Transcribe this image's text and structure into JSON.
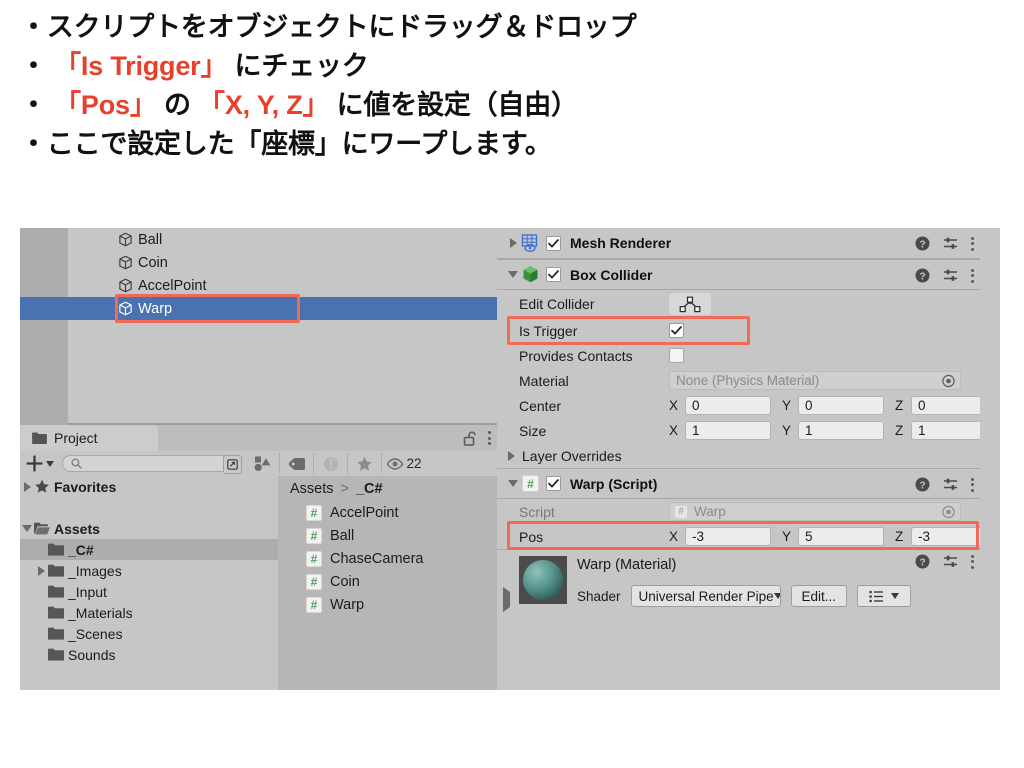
{
  "slide": {
    "bullets": [
      {
        "id": "b1",
        "segments": [
          {
            "t": "・スクリプトをオブジェクトにドラッグ＆ドロップ",
            "c": "black"
          }
        ]
      },
      {
        "id": "b2",
        "segments": [
          {
            "t": "・  ",
            "c": "black"
          },
          {
            "t": "「Is Trigger」",
            "c": "red"
          },
          {
            "t": " にチェック",
            "c": "black"
          }
        ]
      },
      {
        "id": "b3",
        "segments": [
          {
            "t": "・  ",
            "c": "black"
          },
          {
            "t": "「Pos」",
            "c": "red"
          },
          {
            "t": " の ",
            "c": "black"
          },
          {
            "t": "「X, Y, Z」",
            "c": "red"
          },
          {
            "t": " に値を設定（自由）",
            "c": "black"
          }
        ]
      },
      {
        "id": "b4",
        "segments": [
          {
            "t": "・ここで設定した「座標」にワープします。",
            "c": "black"
          }
        ]
      }
    ],
    "accent_red": "#E8412B",
    "text_black": "#111111"
  },
  "hierarchy": {
    "items": [
      {
        "name": "Ball",
        "selected": false
      },
      {
        "name": "Coin",
        "selected": false
      },
      {
        "name": "AccelPoint",
        "selected": false
      },
      {
        "name": "Warp",
        "selected": true
      }
    ],
    "selection_color": "#4a72b0",
    "highlight_color": "#f06a55"
  },
  "project": {
    "tab_label": "Project",
    "lock_icon": "open-padlock-icon",
    "menu_icon": "kebab-menu-icon",
    "add_button_label": "+",
    "search_placeholder": "",
    "visibility_count": "22",
    "toolbar_icons": [
      "object-type-filter-icon",
      "label-filter-icon",
      "warning-filter-icon",
      "favorites-star-icon",
      "eye-icon"
    ],
    "tree": [
      {
        "label": "Favorites",
        "indent": 0,
        "arrow": "right",
        "icon": "star-icon",
        "bold": true,
        "selected": false
      },
      {
        "label": "",
        "indent": 0,
        "arrow": "none",
        "icon": "none",
        "bold": false,
        "selected": false
      },
      {
        "label": "Assets",
        "indent": 0,
        "arrow": "down",
        "icon": "open-folder-icon",
        "bold": true,
        "selected": false
      },
      {
        "label": "_C#",
        "indent": 1,
        "arrow": "none",
        "icon": "folder-icon",
        "bold": true,
        "selected": true
      },
      {
        "label": "_Images",
        "indent": 1,
        "arrow": "right",
        "icon": "folder-icon",
        "bold": false,
        "selected": false
      },
      {
        "label": "_Input",
        "indent": 1,
        "arrow": "none",
        "icon": "folder-icon",
        "bold": false,
        "selected": false
      },
      {
        "label": "_Materials",
        "indent": 1,
        "arrow": "none",
        "icon": "folder-icon",
        "bold": false,
        "selected": false
      },
      {
        "label": "_Scenes",
        "indent": 1,
        "arrow": "none",
        "icon": "folder-icon",
        "bold": false,
        "selected": false
      },
      {
        "label": "Sounds",
        "indent": 1,
        "arrow": "none",
        "icon": "folder-icon",
        "bold": false,
        "selected": false
      }
    ],
    "breadcrumb": {
      "root": "Assets",
      "separator": ">",
      "current": "_C#"
    },
    "assets": [
      {
        "name": "AccelPoint",
        "icon": "csharp-script-icon"
      },
      {
        "name": "Ball",
        "icon": "csharp-script-icon"
      },
      {
        "name": "ChaseCamera",
        "icon": "csharp-script-icon"
      },
      {
        "name": "Coin",
        "icon": "csharp-script-icon"
      },
      {
        "name": "Warp",
        "icon": "csharp-script-icon"
      }
    ]
  },
  "inspector": {
    "mesh_renderer": {
      "title": "Mesh Renderer",
      "enabled": true,
      "foldout": "collapsed",
      "icon": "mesh-renderer-icon"
    },
    "box_collider": {
      "title": "Box Collider",
      "enabled": true,
      "foldout": "expanded",
      "icon": "box-collider-icon",
      "edit_collider_label": "Edit Collider",
      "is_trigger_label": "Is Trigger",
      "is_trigger_value": true,
      "provides_contacts_label": "Provides Contacts",
      "provides_contacts_value": false,
      "material_label": "Material",
      "material_value": "None (Physics Material)",
      "center_label": "Center",
      "center": {
        "x": "0",
        "y": "0",
        "z": "0"
      },
      "size_label": "Size",
      "size": {
        "x": "1",
        "y": "1",
        "z": "1"
      },
      "layer_overrides_label": "Layer Overrides"
    },
    "warp_script": {
      "title": "Warp (Script)",
      "enabled": true,
      "foldout": "expanded",
      "icon": "csharp-script-icon",
      "script_label": "Script",
      "script_value": "Warp",
      "pos_label": "Pos",
      "pos": {
        "x": "-3",
        "y": "5",
        "z": "-3"
      }
    },
    "material": {
      "title": "Warp (Material)",
      "shader_label": "Shader",
      "shader_value": "Universal Render Pipe",
      "edit_button_label": "Edit...",
      "preset_icon": "preset-list-icon"
    },
    "axis_labels": {
      "x": "X",
      "y": "Y",
      "z": "Z"
    },
    "header_icons": [
      "help-icon",
      "preset-icon",
      "kebab-menu-icon"
    ]
  }
}
